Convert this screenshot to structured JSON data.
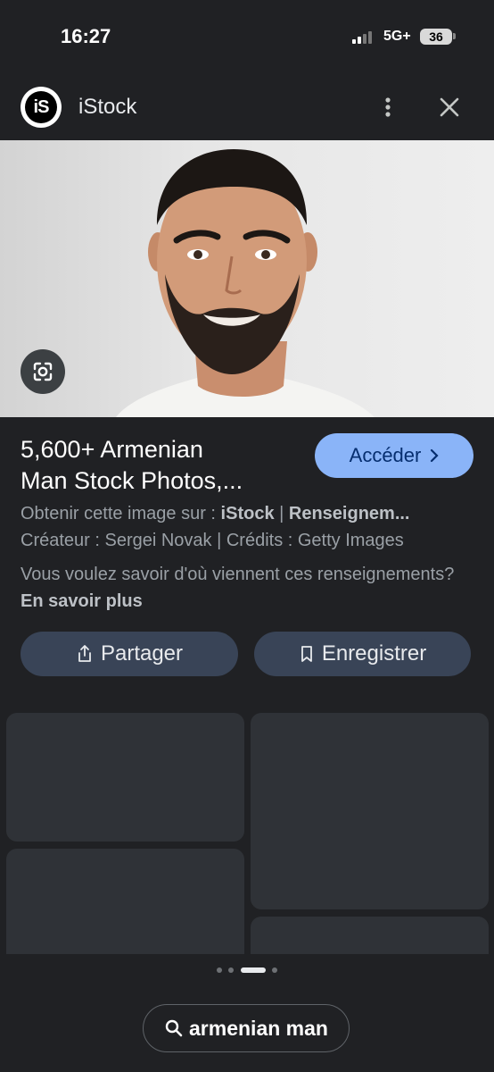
{
  "status_bar": {
    "time": "16:27",
    "network": "5G+",
    "battery": "36"
  },
  "header": {
    "site_name": "iStock",
    "logo_text": "iS"
  },
  "result": {
    "title_line1": "5,600+ Armenian",
    "title_line2": "Man Stock Photos,...",
    "visit_label": "Accéder",
    "source_prefix": "Obtenir cette image sur : ",
    "source_name": "iStock",
    "source_sep": " | ",
    "source_info": "Renseignem...",
    "credits_line": "Créateur : Sergei Novak | Crédits : Getty Images",
    "info_question": "Vous voulez savoir d'où viennent ces renseignements?",
    "learn_more": "En savoir plus"
  },
  "actions": {
    "share_label": "Partager",
    "save_label": "Enregistrer"
  },
  "search": {
    "query": "armenian man"
  },
  "colors": {
    "accent": "#8ab4f8",
    "background": "#202124",
    "button": "#394457"
  }
}
